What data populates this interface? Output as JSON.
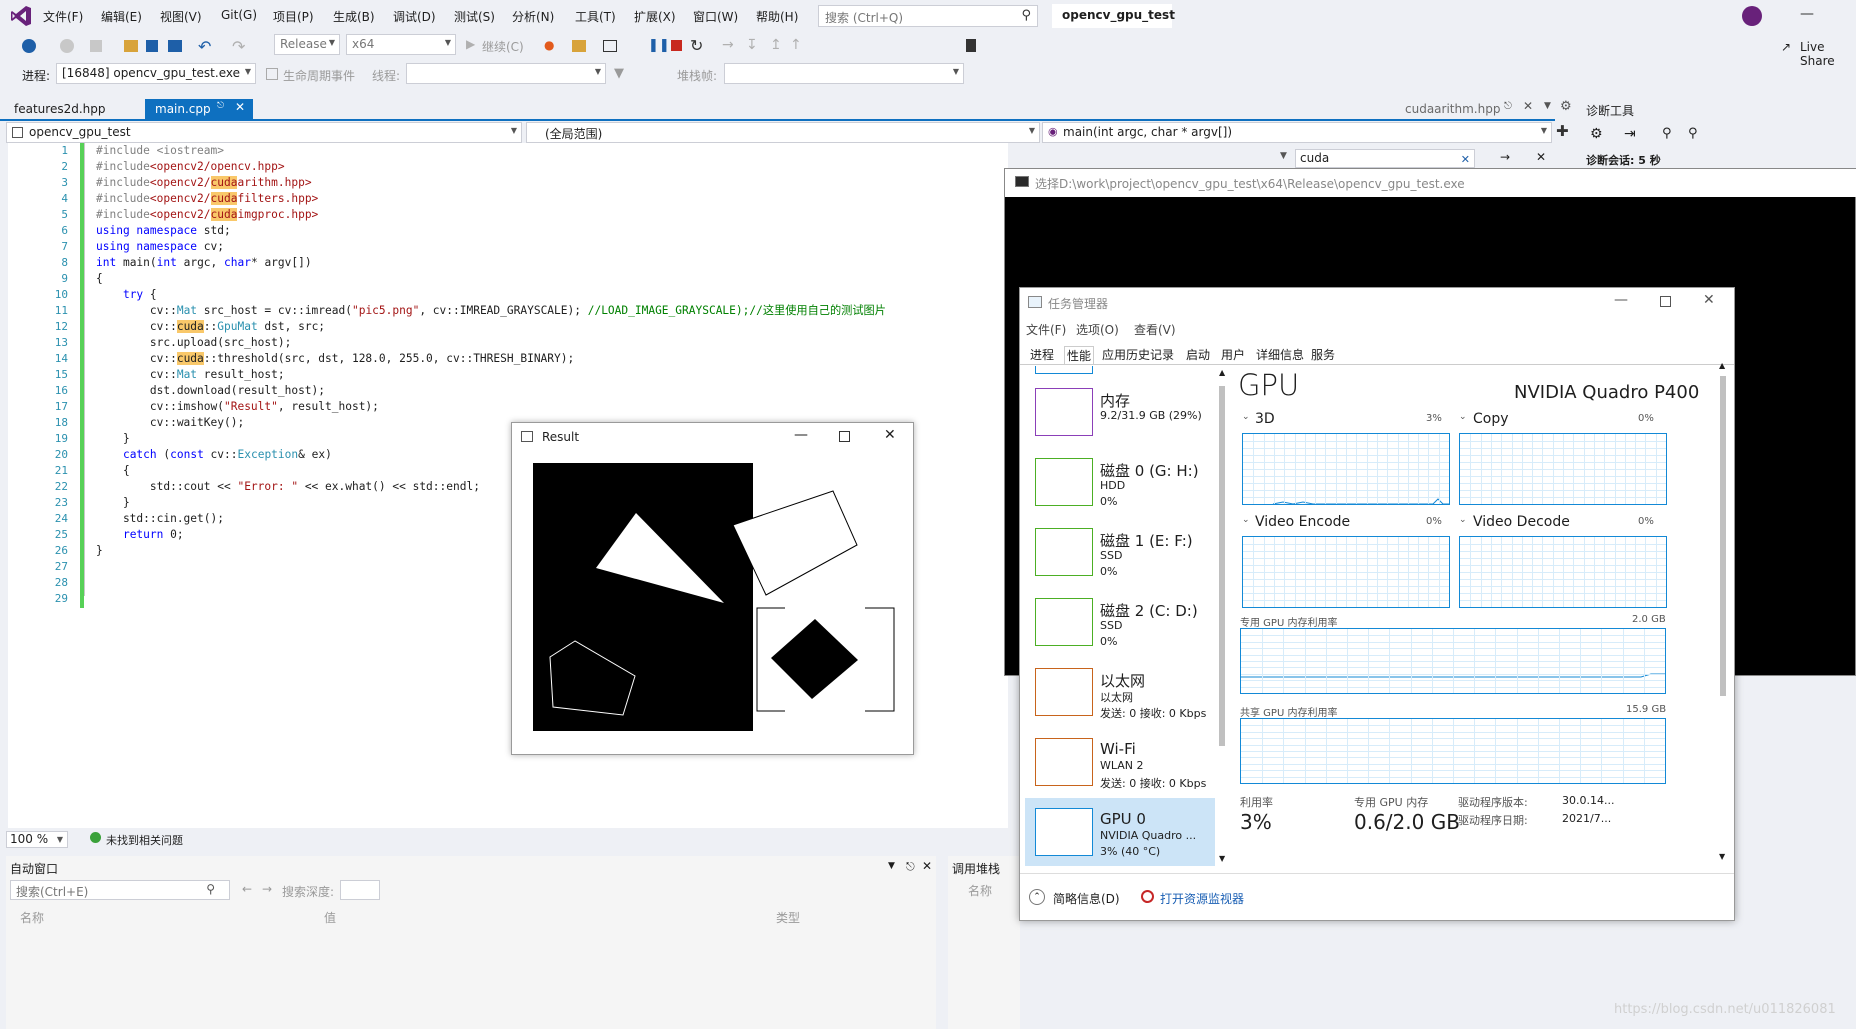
{
  "menu": [
    "文件(F)",
    "编辑(E)",
    "视图(V)",
    "Git(G)",
    "项目(P)",
    "生成(B)",
    "调试(D)",
    "测试(S)",
    "分析(N)",
    "工具(T)",
    "扩展(X)",
    "窗口(W)",
    "帮助(H)"
  ],
  "search": {
    "placeholder": "搜索 (Ctrl+Q)"
  },
  "solution_name": "opencv_gpu_test",
  "live_share": "Live Share",
  "toolbar": {
    "config": "Release",
    "platform": "x64",
    "continue": "继续(C)"
  },
  "process": {
    "label": "进程:",
    "value": "[16848] opencv_gpu_test.exe",
    "lifecycle": "生命周期事件",
    "thread": "线程:",
    "stack": "堆栈帧:"
  },
  "tabs": {
    "left": "features2d.hpp",
    "active": "main.cpp",
    "right": "cudaarithm.hpp"
  },
  "nav": {
    "project": "opencv_gpu_test",
    "scope": "(全局范围)",
    "func": "main(int argc, char * argv[])"
  },
  "find": {
    "value": "cuda"
  },
  "diag": {
    "title": "诊断工具",
    "session": "诊断会话: 5 秒"
  },
  "code": {
    "line_numbers": [
      "1",
      "2",
      "3",
      "4",
      "5",
      "6",
      "7",
      "8",
      "9",
      "10",
      "11",
      "12",
      "13",
      "14",
      "15",
      "16",
      "17",
      "18",
      "19",
      "20",
      "21",
      "22",
      "23",
      "24",
      "25",
      "26",
      "27",
      "28",
      "29"
    ]
  },
  "zoom": "100 %",
  "issues": "未找到相关问题",
  "auto_window": {
    "title": "自动窗口",
    "search": "搜索(Ctrl+E)",
    "depth": "搜索深度:",
    "col_name": "名称",
    "col_value": "值",
    "col_type": "类型"
  },
  "call_stack": {
    "title": "调用堆栈",
    "col_name": "名称"
  },
  "result_window": {
    "title": "Result"
  },
  "cmd_window": {
    "title": "选择D:\\work\\project\\opencv_gpu_test\\x64\\Release\\opencv_gpu_test.exe"
  },
  "task_manager": {
    "title": "任务管理器",
    "menu": [
      "文件(F)",
      "选项(O)",
      "查看(V)"
    ],
    "tabs": [
      "进程",
      "性能",
      "应用历史记录",
      "启动",
      "用户",
      "详细信息",
      "服务"
    ],
    "side": [
      {
        "name": "内存",
        "sub": "9.2/31.9 GB (29%)",
        "sub2": "",
        "color": "#8b3fb8"
      },
      {
        "name": "磁盘 0 (G: H:)",
        "sub": "HDD",
        "sub2": "0%",
        "color": "#4caf24"
      },
      {
        "name": "磁盘 1 (E: F:)",
        "sub": "SSD",
        "sub2": "0%",
        "color": "#4caf24"
      },
      {
        "name": "磁盘 2 (C: D:)",
        "sub": "SSD",
        "sub2": "0%",
        "color": "#4caf24"
      },
      {
        "name": "以太网",
        "sub": "以太网",
        "sub2": "发送: 0 接收: 0 Kbps",
        "color": "#c8641c"
      },
      {
        "name": "Wi-Fi",
        "sub": "WLAN 2",
        "sub2": "发送: 0 接收: 0 Kbps",
        "color": "#c8641c"
      },
      {
        "name": "GPU 0",
        "sub": "NVIDIA Quadro ...",
        "sub2": "3% (40 °C)",
        "color": "#1389d6"
      }
    ],
    "gpu_title": "GPU",
    "gpu_model": "NVIDIA Quadro P400",
    "g3d": "3D",
    "g3d_pct": "3%",
    "copy": "Copy",
    "copy_pct": "0%",
    "venc": "Video Encode",
    "venc_pct": "0%",
    "vdec": "Video Decode",
    "vdec_pct": "0%",
    "dedicated": "专用 GPU 内存利用率",
    "dedicated_max": "2.0 GB",
    "shared": "共享 GPU 内存利用率",
    "shared_max": "15.9 GB",
    "util_label": "利用率",
    "util": "3%",
    "mem_label": "专用 GPU 内存",
    "mem": "0.6/2.0 GB",
    "drv_ver_label": "驱动程序版本:",
    "drv_ver": "30.0.14...",
    "drv_date_label": "驱动程序日期:",
    "drv_date": "2021/7...",
    "brief": "简略信息(D)",
    "monitor": "打开资源监视器"
  },
  "watermark": "https://blog.csdn.net/u011826081"
}
